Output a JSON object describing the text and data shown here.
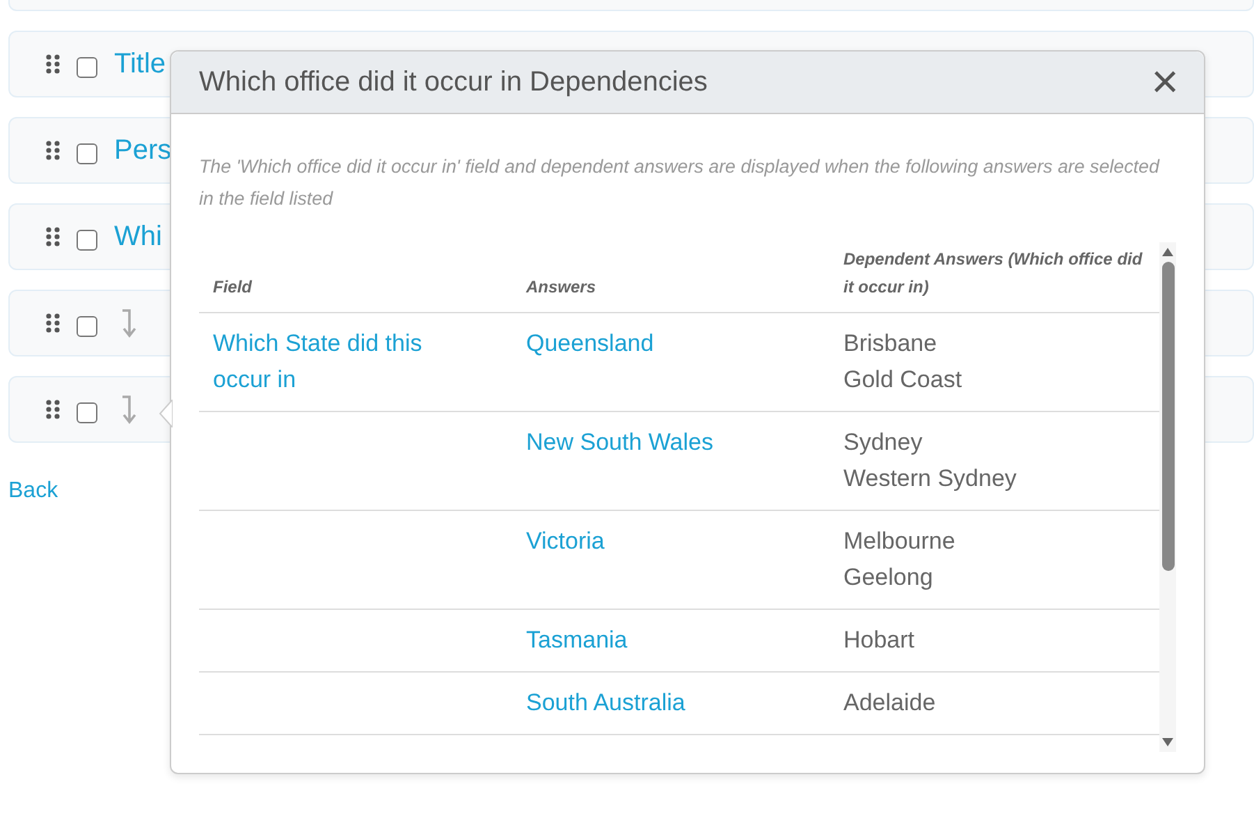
{
  "list_rows": [
    {
      "label": "Title",
      "checked": false,
      "dependent": false
    },
    {
      "label": "Pers",
      "checked": false,
      "dependent": false
    },
    {
      "label": "Whi",
      "checked": false,
      "dependent": false
    },
    {
      "checked": false,
      "dependent": true
    },
    {
      "checked": false,
      "dependent": true
    }
  ],
  "back_link": "Back",
  "popover": {
    "title": "Which office did it occur in Dependencies",
    "close": "×",
    "description": "The 'Which office did it occur in' field and dependent answers are displayed when the following answers are selected in the field listed",
    "columns": [
      "Field",
      "Answers",
      "Dependent Answers (Which office did it occur in)"
    ],
    "rows": [
      {
        "field": "Which State did this occur in",
        "answer": "Queensland",
        "dependents": [
          "Brisbane",
          "Gold Coast"
        ]
      },
      {
        "answer": "New South Wales",
        "dependents": [
          "Sydney",
          "Western Sydney"
        ]
      },
      {
        "answer": "Victoria",
        "dependents": [
          "Melbourne",
          "Geelong"
        ]
      },
      {
        "answer": "Tasmania",
        "dependents": [
          "Hobart"
        ]
      },
      {
        "answer": "South Australia",
        "dependents": [
          "Adelaide"
        ]
      }
    ]
  }
}
